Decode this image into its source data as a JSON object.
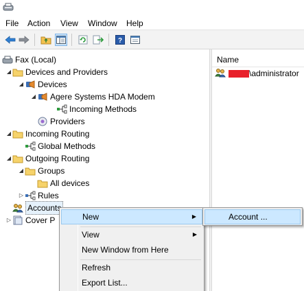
{
  "menubar": {
    "items": [
      "File",
      "Action",
      "View",
      "Window",
      "Help"
    ]
  },
  "toolbar": {
    "buttons": [
      "back-icon",
      "forward-icon",
      "up-folder-icon",
      "show-hide-tree-icon",
      "refresh-icon",
      "export-list-icon",
      "help-icon",
      "properties-icon"
    ]
  },
  "tree": {
    "root": "Fax (Local)",
    "devices_and_providers": "Devices and Providers",
    "devices": "Devices",
    "modem": "Agere Systems HDA Modem",
    "incoming_methods": "Incoming Methods",
    "providers": "Providers",
    "incoming_routing": "Incoming Routing",
    "global_methods": "Global Methods",
    "outgoing_routing": "Outgoing Routing",
    "groups": "Groups",
    "all_devices": "All devices",
    "rules": "Rules",
    "accounts": "Accounts",
    "cover_pages": "Cover P"
  },
  "list": {
    "column_name": "Name",
    "rows": [
      {
        "suffix": "\\administrator"
      }
    ]
  },
  "context_menu": {
    "new": "New",
    "view": "View",
    "new_window": "New Window from Here",
    "refresh": "Refresh",
    "export_list": "Export List..."
  },
  "submenu": {
    "account": "Account ..."
  },
  "colors": {
    "accent": "#cce8ff",
    "redaction": "#e8202a"
  }
}
